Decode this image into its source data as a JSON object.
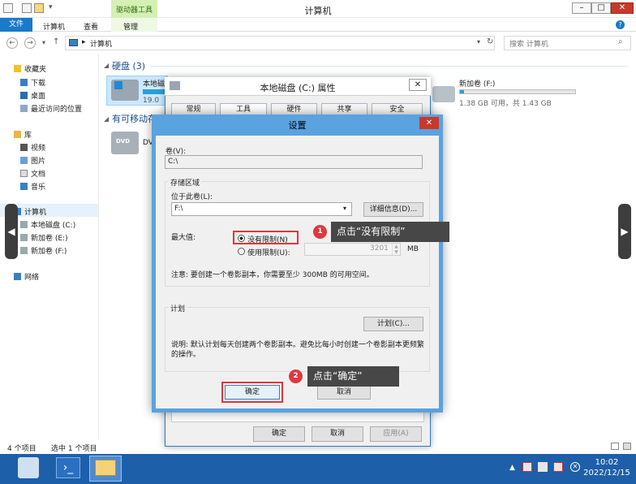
{
  "window": {
    "title": "计算机",
    "context_tab_group": "驱动器工具",
    "minimize": "–",
    "maximize": "□",
    "close": "✕"
  },
  "ribbon": {
    "tabs": [
      "文件",
      "计算机",
      "查看",
      "管理"
    ]
  },
  "address": {
    "path": "计算机",
    "search_placeholder": "搜索 计算机"
  },
  "nav": {
    "favorites": "收藏夹",
    "fav_items": [
      "下载",
      "桌面",
      "最近访问的位置"
    ],
    "library": "库",
    "lib_items": [
      "视频",
      "图片",
      "文档",
      "音乐"
    ],
    "computer": "计算机",
    "drives": [
      "本地磁盘 (C:)",
      "新加卷 (E:)",
      "新加卷 (F:)"
    ],
    "network": "网络"
  },
  "content": {
    "hard_disks_heading": "硬盘 (3)",
    "removable_heading": "有可移动存",
    "drive_c_name": "本地磁",
    "drive_c_size": "19.0",
    "drive_f_name": "新加卷 (F:)",
    "drive_f_size": "1.38 GB 可用，共 1.43 GB",
    "drive_f_used_fraction": 0.035,
    "dvd_label": "DV"
  },
  "status": {
    "items": "4 个项目",
    "selected": "选中 1 个项目"
  },
  "taskbar": {
    "time": "10:02",
    "date": "2022/12/15"
  },
  "props_dialog": {
    "title": "本地磁盘 (C:) 属性",
    "tabs": [
      "常规",
      "工具",
      "硬件",
      "共享",
      "安全"
    ],
    "ok": "确定",
    "cancel": "取消",
    "apply": "应用(A)"
  },
  "settings_dialog": {
    "title": "设置",
    "volume_label": "卷(V):",
    "volume_value": "C:\\",
    "storage_group": "存储区域",
    "located_on_label": "位于此卷(L):",
    "located_on_value": "F:\\",
    "details_button": "详细信息(D)...",
    "max_label": "最大值:",
    "no_limit": "没有限制(N)",
    "use_limit": "使用限制(U):",
    "limit_value": "3201",
    "limit_unit": "MB",
    "note": "注意: 要创建一个卷影副本，你需要至少 300MB 的可用空间。",
    "schedule_group": "计划",
    "schedule_button": "计划(C)...",
    "description": "说明: 默认计划每天创建两个卷影副本。避免比每小时创建一个卷影副本更频繁的操作。",
    "ok": "确定",
    "cancel": "取消"
  },
  "callouts": [
    {
      "num": "1",
      "text": "点击“没有限制”"
    },
    {
      "num": "2",
      "text": "点击“确定”"
    }
  ],
  "colors": {
    "accent": "#1979ca",
    "dialog_border": "#5aa2e0",
    "highlight_red": "#e0373f",
    "callout_bg": "#474747",
    "taskbar": "#1d5fa8"
  }
}
